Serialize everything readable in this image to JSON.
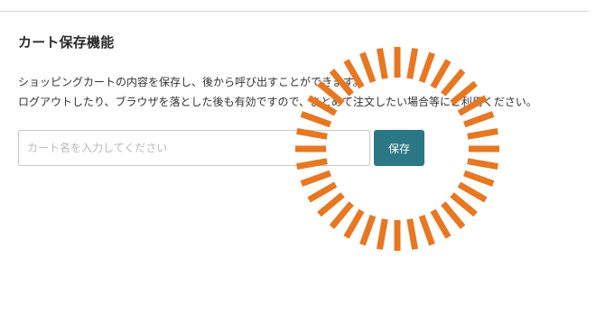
{
  "cart_save": {
    "title": "カート保存機能",
    "description_line1": "ショッピングカートの内容を保存し、後から呼び出すことができます。",
    "description_line2": "ログアウトしたり、ブラウザを落とした後も有効ですので、まとめて注文したい場合等にご利用ください。",
    "name_placeholder": "カート名を入力してください",
    "name_value": "",
    "save_label": "保存"
  },
  "colors": {
    "save_button": "#2b7785",
    "spinner": "#e87722"
  },
  "icons": {
    "spinner": "loading-spinner-icon"
  }
}
